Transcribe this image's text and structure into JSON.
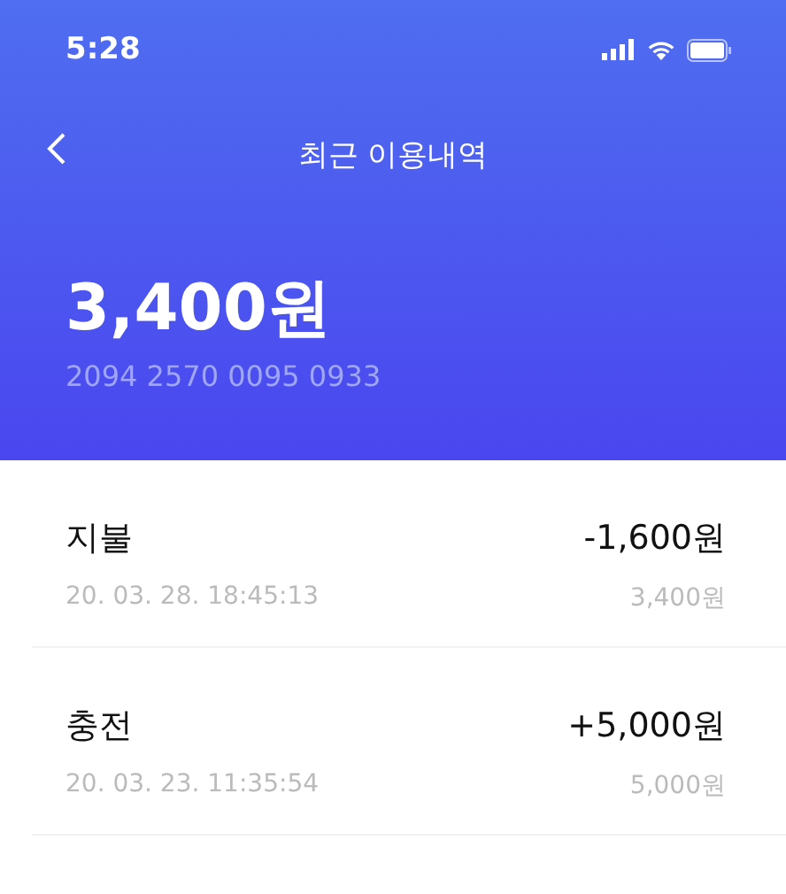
{
  "status_bar": {
    "time": "5:28"
  },
  "nav": {
    "title": "최근 이용내역"
  },
  "balance": {
    "amount": "3,400원",
    "card_number": "2094 2570 0095 0933"
  },
  "transactions": [
    {
      "type": "지불",
      "datetime": "20. 03. 28. 18:45:13",
      "amount": "-1,600원",
      "balance": "3,400원"
    },
    {
      "type": "충전",
      "datetime": "20. 03. 23. 11:35:54",
      "amount": "+5,000원",
      "balance": "5,000원"
    }
  ]
}
